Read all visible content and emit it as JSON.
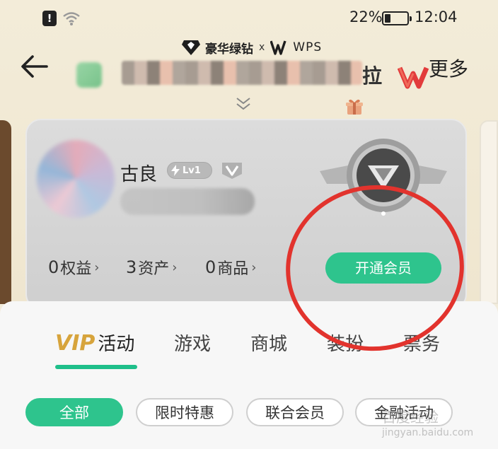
{
  "status_bar": {
    "notification_glyph": "!",
    "battery_percent": "22%",
    "time": "12:04",
    "icons": [
      "notification-icon",
      "wifi-icon",
      "battery-icon"
    ]
  },
  "header": {
    "brand": "豪华绿钻",
    "brand_separator": "x",
    "partner": "WPS",
    "title_visible_suffix": "拉",
    "more_label": "更多",
    "icons": [
      "back-arrow-icon",
      "diamond-icon",
      "wps-logo-icon",
      "wps-red-icon",
      "expand-chevron-icon",
      "gift-icon"
    ]
  },
  "card": {
    "username": "古良",
    "level": "Lv1",
    "stats": [
      {
        "num": "0",
        "label": "权益",
        "chevron": "›"
      },
      {
        "num": "3",
        "label": "资产",
        "chevron": "›"
      },
      {
        "num": "0",
        "label": "商品",
        "chevron": "›"
      }
    ],
    "open_member_label": "开通会员"
  },
  "tabs": {
    "active_prefix": "VIP",
    "active_label": "活动",
    "items": [
      "游戏",
      "商城",
      "装扮",
      "票务"
    ]
  },
  "filters": [
    "全部",
    "限时特惠",
    "联合会员",
    "金融活动"
  ],
  "colors": {
    "accent_green": "#2ec48d",
    "vip_gold": "#d7a43c",
    "annotation_red": "#e2332d"
  },
  "watermark": {
    "text": "百度经验",
    "url": "jingyan.baidu.com"
  }
}
